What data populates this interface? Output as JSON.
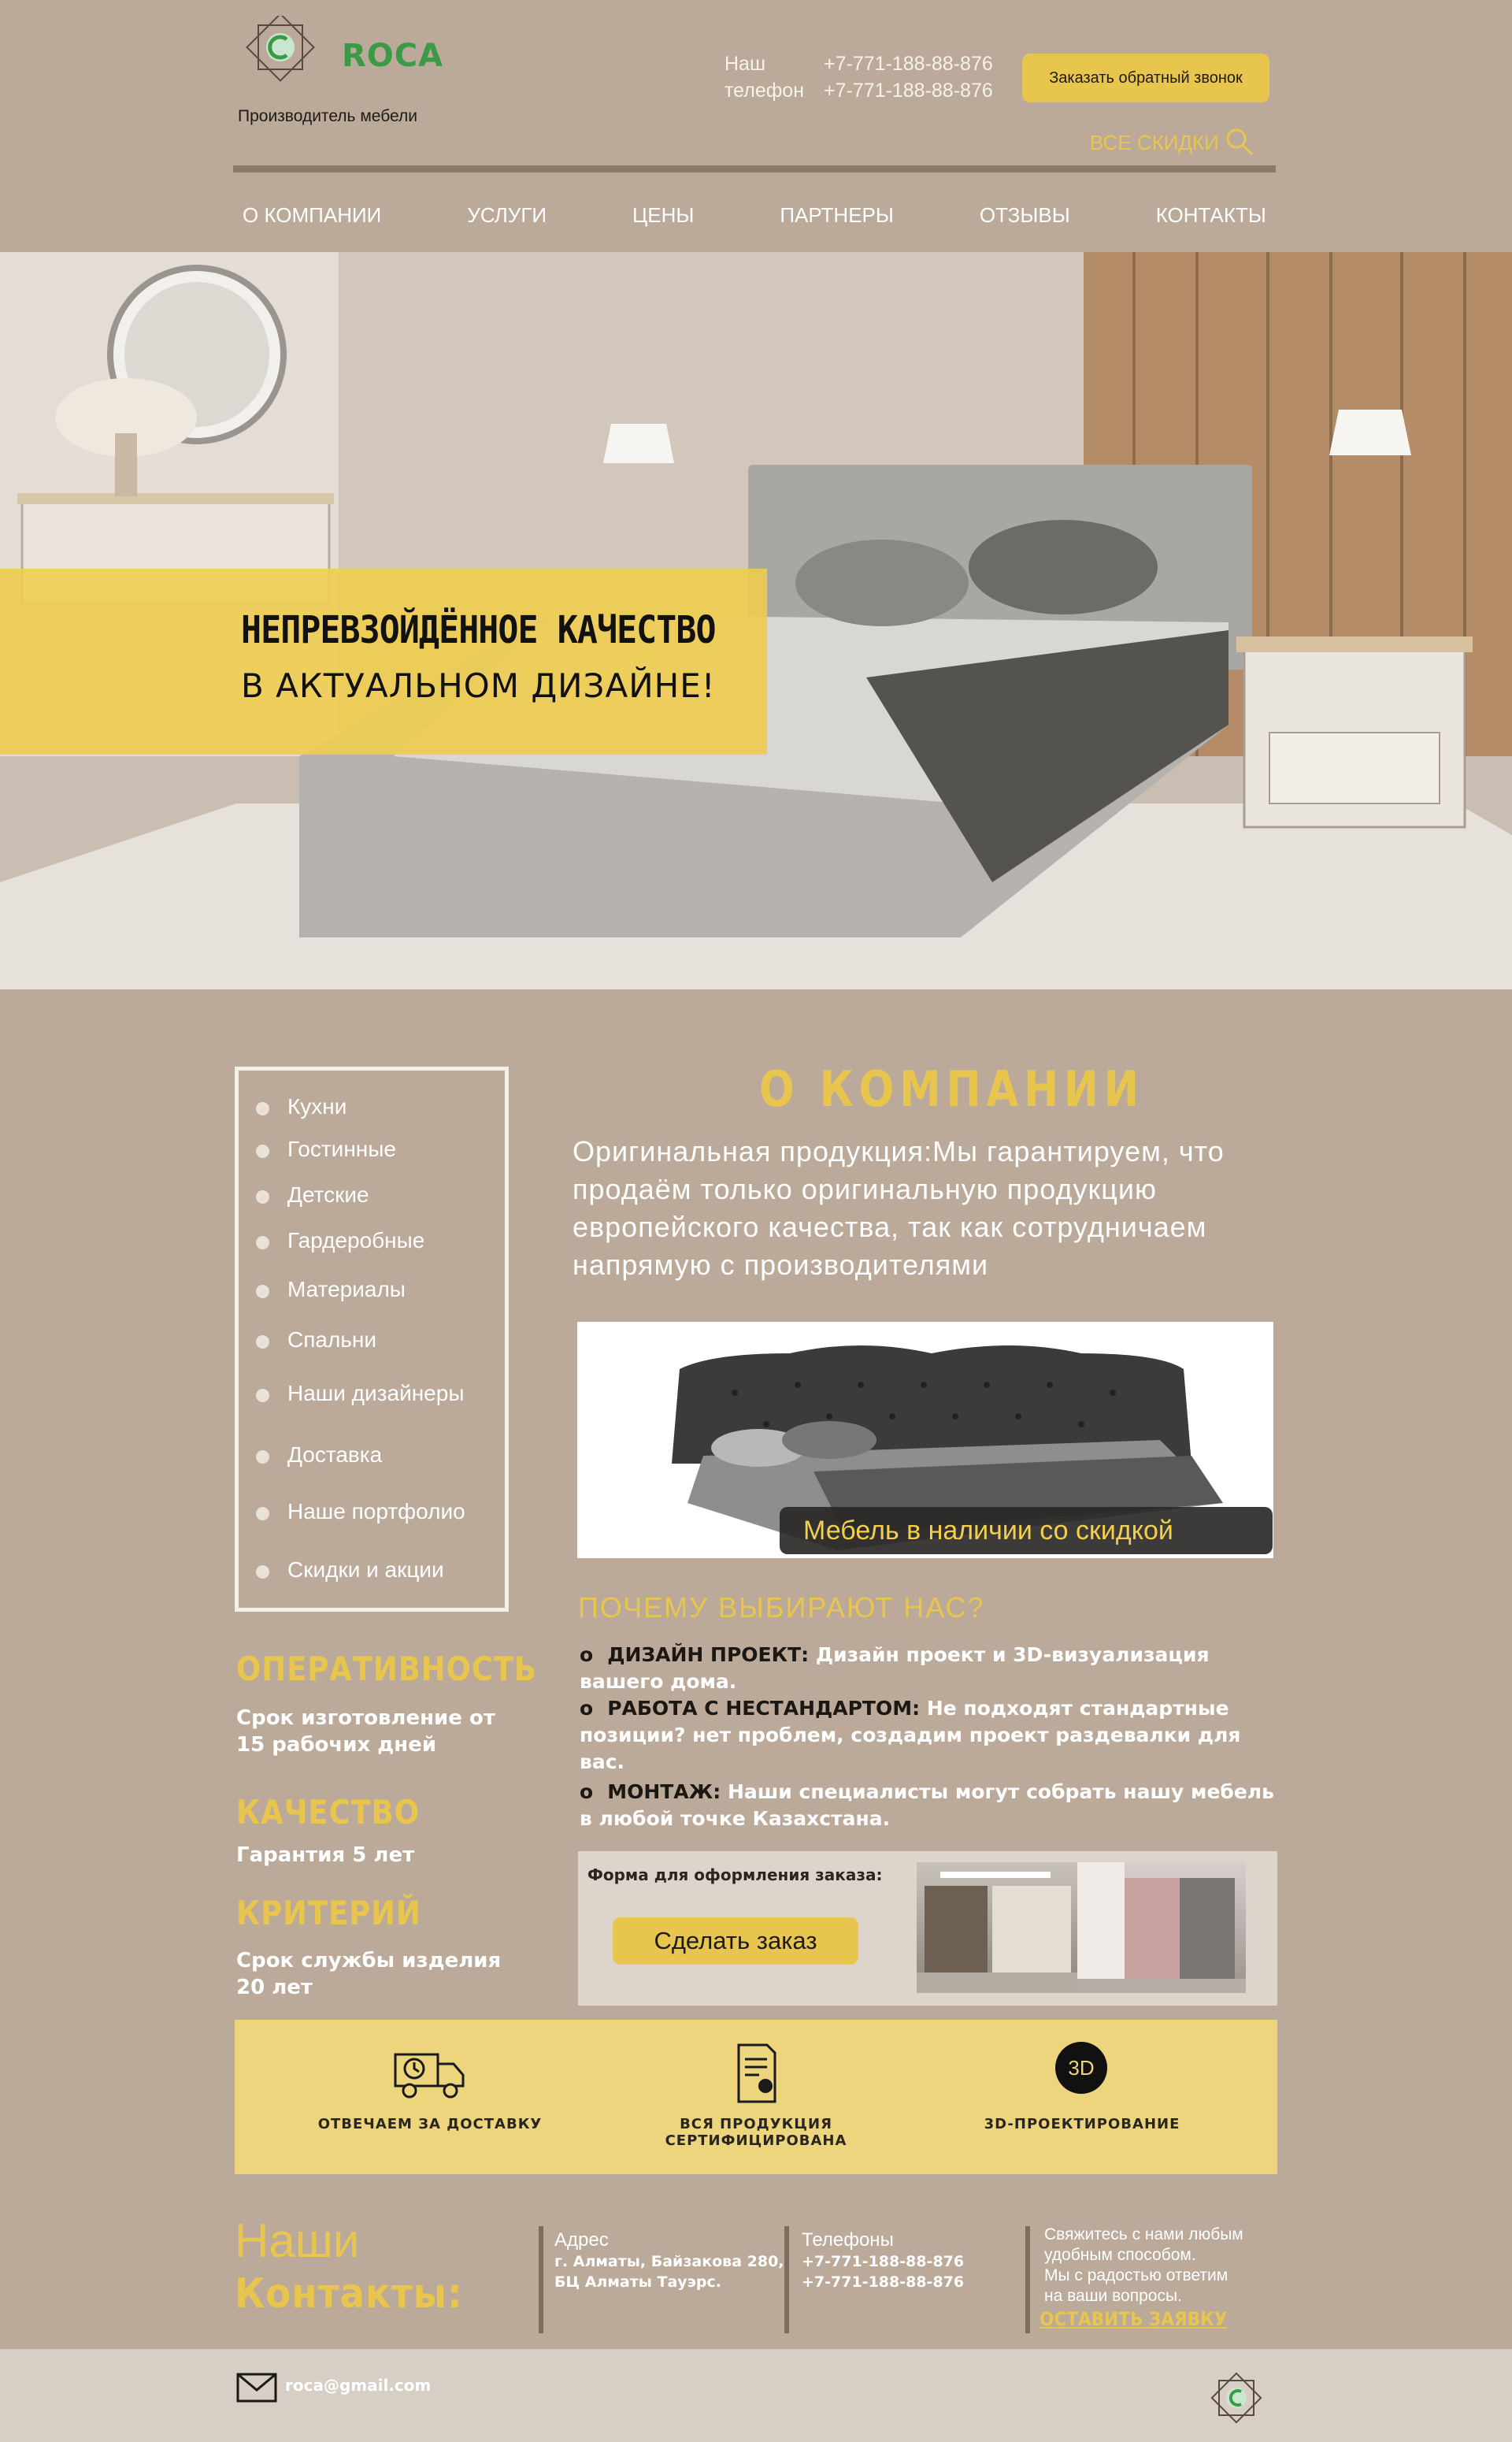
{
  "header": {
    "brand": "ROCA",
    "tagline": "Производитель мебели",
    "phone_label": "Наш телефон",
    "phones": [
      "+7-771-188-88-876",
      "+7-771-188-88-876"
    ],
    "callback_label": "Заказать обратный звонок",
    "discounts_label": "ВСЕ СКИДКИ"
  },
  "nav": [
    "О КОМПАНИИ",
    "УСЛУГИ",
    "ЦЕНЫ",
    "ПАРТНЕРЫ",
    "ОТЗЫВЫ",
    "КОНТАКТЫ"
  ],
  "hero": {
    "title": "НЕПРЕВЗОЙДЁННОЕ КАЧЕСТВО",
    "subtitle": "В АКТУАЛЬНОМ ДИЗАЙНЕ!"
  },
  "sidebar": [
    "Кухни",
    "Гостинные",
    "Детские",
    "Гардеробные",
    "Материалы",
    "Спальни",
    "Наши дизайнеры",
    "Доставка",
    "Наше портфолио",
    "Скидки и акции"
  ],
  "features": [
    {
      "title": "ОПЕРАТИВНОСТЬ",
      "text": "Срок изготовление от 15 рабочих дней"
    },
    {
      "title": "КАЧЕСТВО",
      "text": "Гарантия 5 лет"
    },
    {
      "title": "КРИТЕРИЙ",
      "text": "Срок службы изделия 20 лет"
    }
  ],
  "about": {
    "title": "О КОМПАНИИ",
    "text": "Оригинальная продукция:Мы гарантируем, что продаём только оригинальную продукцию европейского качества, так как сотрудничаем напрямую с производителями",
    "product_caption": "Мебель в наличии со скидкой"
  },
  "why": {
    "title": "ПОЧЕМУ ВЫБИРАЮТ НАС?",
    "items": [
      {
        "bullet": "o",
        "key": "ДИЗАЙН ПРОЕКТ:",
        "text": " Дизайн проект и 3D-визуализация вашего дома."
      },
      {
        "bullet": "o",
        "key": "РАБОТА С НЕСТАНДАРТОМ:",
        "text": " Не подходят стандартные позиции? нет проблем, создадим проект раздевалки для вас."
      },
      {
        "bullet": "o",
        "key": "МОНТАЖ:",
        "text": " Наши специалисты могут собрать нашу мебель в любой точке Казахстана."
      }
    ]
  },
  "order": {
    "label": "Форма для оформления заказа:",
    "button": "Сделать заказ"
  },
  "benefits": [
    "ОТВЕЧАЕМ ЗА ДОСТАВКУ",
    "ВСЯ ПРОДУКЦИЯ СЕРТИФИЦИРОВАНА",
    "3D-ПРОЕКТИРОВАНИЕ"
  ],
  "benefit_icons": [
    "delivery-truck-icon",
    "certificate-icon",
    "3d-icon"
  ],
  "icon_3d_text": "3D",
  "contacts": {
    "title_line1": "Наши",
    "title_line2": "Контакты:",
    "address_head": "Адрес",
    "address_lines": [
      "г. Алматы, Байзакова 280,",
      "БЦ Алматы Тауэрс."
    ],
    "phones_head": "Телефоны",
    "phones": [
      "+7-771-188-88-876",
      "+7-771-188-88-876"
    ],
    "note_lines": [
      "Свяжитесь с нами любым",
      "удобным способом.",
      "Мы с радостью ответим",
      "на ваши вопросы."
    ],
    "cta": "ОСТАВИТЬ ЗАЯВКУ"
  },
  "footer": {
    "email": "roca@gmail.com"
  },
  "colors": {
    "background": "#bba999",
    "accent": "#e8c64e",
    "brand_green": "#3a9a46",
    "footer": "#d7cec5",
    "band": "#ecd57d"
  }
}
